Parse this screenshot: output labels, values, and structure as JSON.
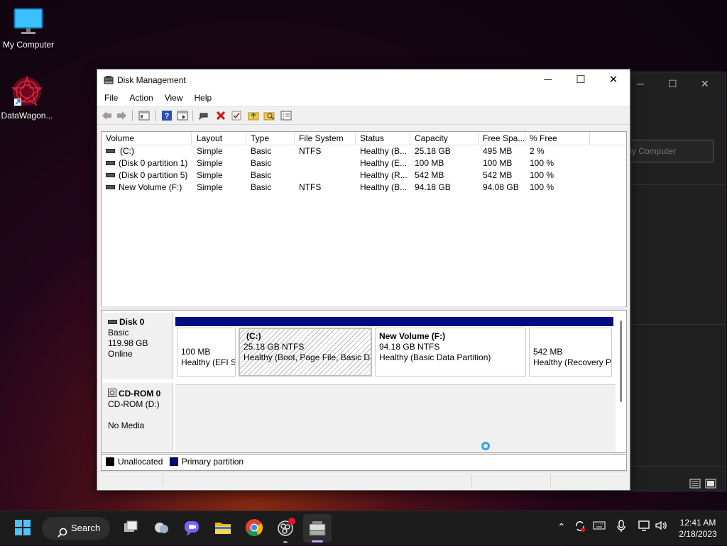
{
  "desktop": {
    "icons": [
      {
        "label": "My Computer"
      },
      {
        "label": "DataWagon..."
      }
    ]
  },
  "background_window": {
    "field_text": "My Computer"
  },
  "window": {
    "title": "Disk Management",
    "menu": [
      "File",
      "Action",
      "View",
      "Help"
    ],
    "columns": [
      "Volume",
      "Layout",
      "Type",
      "File System",
      "Status",
      "Capacity",
      "Free Spa...",
      "% Free"
    ],
    "volumes": [
      [
        "(C:)",
        "Simple",
        "Basic",
        "NTFS",
        "Healthy (B...",
        "25.18 GB",
        "495 MB",
        "2 %"
      ],
      [
        "(Disk 0 partition 1)",
        "Simple",
        "Basic",
        "",
        "Healthy (E...",
        "100 MB",
        "100 MB",
        "100 %"
      ],
      [
        "(Disk 0 partition 5)",
        "Simple",
        "Basic",
        "",
        "Healthy (R...",
        "542 MB",
        "542 MB",
        "100 %"
      ],
      [
        "New Volume (F:)",
        "Simple",
        "Basic",
        "NTFS",
        "Healthy (B...",
        "94.18 GB",
        "94.08 GB",
        "100 %"
      ]
    ],
    "disk0": {
      "name": "Disk 0",
      "type": "Basic",
      "size": "119.98 GB",
      "state": "Online",
      "partitions": [
        {
          "title": "",
          "size": "100 MB",
          "status": "Healthy (EFI S"
        },
        {
          "title": "(C:)",
          "size": "25.18 GB NTFS",
          "status": "Healthy (Boot, Page File, Basic Da"
        },
        {
          "title": "New Volume  (F:)",
          "size": "94.18 GB NTFS",
          "status": "Healthy (Basic Data Partition)"
        },
        {
          "title": "",
          "size": "542 MB",
          "status": "Healthy (Recovery P"
        }
      ]
    },
    "cdrom": {
      "name": "CD-ROM 0",
      "drive": "CD-ROM (D:)",
      "media": "No Media"
    },
    "legend": {
      "unallocated": "Unallocated",
      "primary": "Primary partition",
      "unallocated_color": "#000000",
      "primary_color": "#000c7f"
    }
  },
  "taskbar": {
    "search_label": "Search",
    "time": "12:41 AM",
    "date": "2/18/2023"
  }
}
